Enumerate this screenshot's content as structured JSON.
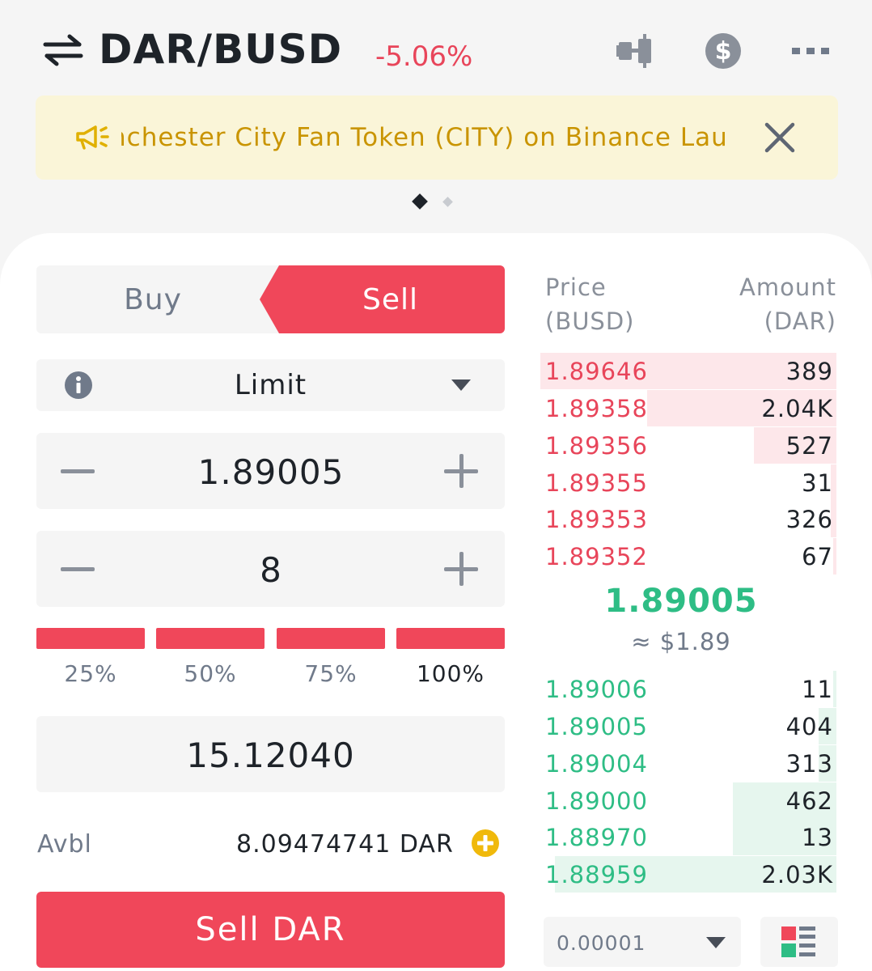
{
  "header": {
    "pair": "DAR/BUSD",
    "change": "-5.06%",
    "icons": [
      "swap-icon",
      "candlestick-chart-icon",
      "dollar-icon",
      "more-icon"
    ]
  },
  "banner": {
    "text": "nchester City Fan Token (CITY) on Binance Lau",
    "icons": [
      "megaphone-icon",
      "close-icon"
    ],
    "page_indicator": {
      "current": 1,
      "total": 2
    }
  },
  "trade": {
    "tabs": {
      "buy": "Buy",
      "sell": "Sell",
      "active": "Sell"
    },
    "order_type": "Limit",
    "price": "1.89005",
    "amount": "8",
    "percent_options": [
      "25%",
      "50%",
      "75%",
      "100%"
    ],
    "percent_selected": "100%",
    "total": "15.12040",
    "avbl_label": "Avbl",
    "avbl_value": "8.09474741 DAR",
    "submit": "Sell DAR"
  },
  "orderbook": {
    "price_header_line1": "Price",
    "price_header_line2": "(BUSD)",
    "amount_header_line1": "Amount",
    "amount_header_line2": "(DAR)",
    "asks": [
      {
        "price": "1.89646",
        "amount": "389",
        "depth": 1.0
      },
      {
        "price": "1.89358",
        "amount": "2.04K",
        "depth": 0.64
      },
      {
        "price": "1.89356",
        "amount": "527",
        "depth": 0.28
      },
      {
        "price": "1.89355",
        "amount": "31",
        "depth": 0.02
      },
      {
        "price": "1.89353",
        "amount": "326",
        "depth": 0.02
      },
      {
        "price": "1.89352",
        "amount": "67",
        "depth": 0.01
      }
    ],
    "mid_price": "1.89005",
    "mid_fiat": "≈ $1.89",
    "bids": [
      {
        "price": "1.89006",
        "amount": "11",
        "depth": 0.01
      },
      {
        "price": "1.89005",
        "amount": "404",
        "depth": 0.06
      },
      {
        "price": "1.89004",
        "amount": "313",
        "depth": 0.06
      },
      {
        "price": "1.89000",
        "amount": "462",
        "depth": 0.35
      },
      {
        "price": "1.88970",
        "amount": "13",
        "depth": 0.35
      },
      {
        "price": "1.88959",
        "amount": "2.03K",
        "depth": 0.95
      }
    ],
    "precision": "0.00001"
  },
  "colors": {
    "sell": "#f0475a",
    "up": "#2ebd85",
    "down": "#e8455a",
    "banner_text": "#c99400",
    "banner_bg": "#faf5d8"
  }
}
